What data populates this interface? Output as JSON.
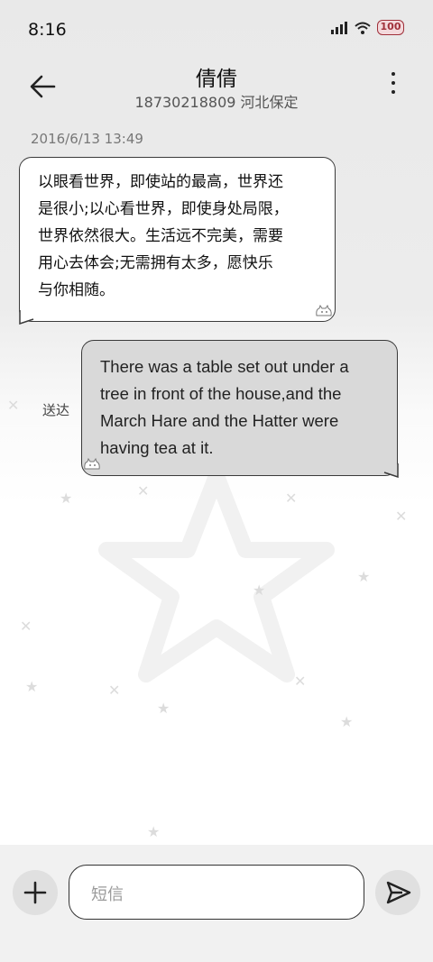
{
  "status_bar": {
    "time": "8:16",
    "battery": "100",
    "icons": [
      "signal-icon",
      "wifi-icon",
      "battery-icon"
    ]
  },
  "header": {
    "name": "倩倩",
    "subtitle": "18730218809 河北保定",
    "back_icon": "back-arrow-icon",
    "menu_icon": "more-vertical-icon"
  },
  "conversation": {
    "timestamp": "2016/6/13 13:49",
    "messages": [
      {
        "direction": "incoming",
        "lines": [
          "以眼看世界，即使站的最高，世界还",
          "是很小;以心看世界，即使身处局限，",
          "世界依然很大。生活远不完美，需要",
          "用心去体会;无需拥有太多，愿快乐",
          "与你相随。"
        ]
      },
      {
        "direction": "outgoing",
        "lines": [
          "There was a table set out under a",
          "tree in front of the house,and the",
          "March Hare and the Hatter were",
          "having tea at it."
        ],
        "status": "送达"
      }
    ]
  },
  "compose": {
    "placeholder": "短信",
    "attach_icon": "plus-icon",
    "send_icon": "send-icon"
  },
  "colors": {
    "incoming_bubble": "#ffffff",
    "outgoing_bubble": "#d9d9d9",
    "bubble_border": "#3a3a3a",
    "battery_accent": "#a0303a"
  }
}
